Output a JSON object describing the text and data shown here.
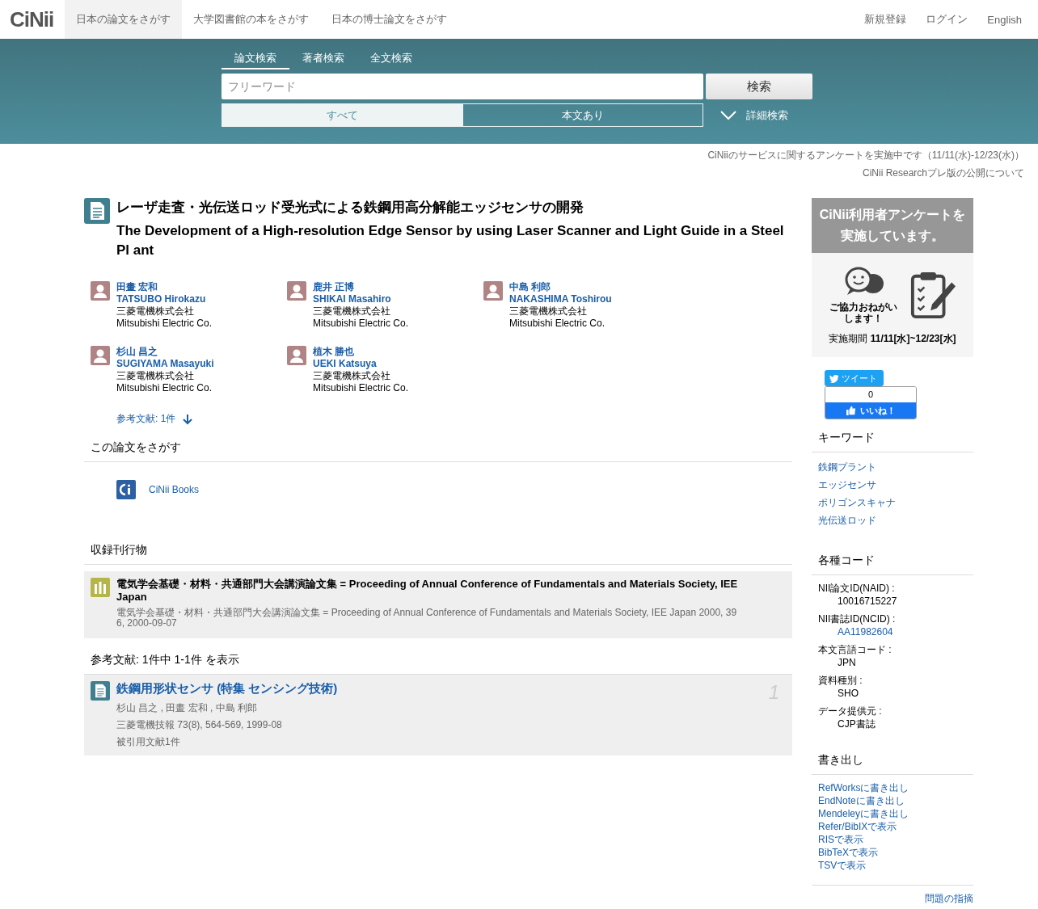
{
  "header": {
    "logo": "CiNii",
    "nav": [
      {
        "label": "日本の論文をさがす",
        "selected": true
      },
      {
        "label": "大学図書館の本をさがす",
        "selected": false
      },
      {
        "label": "日本の博士論文をさがす",
        "selected": false
      }
    ],
    "account": [
      "新規登録",
      "ログイン",
      "English"
    ]
  },
  "search": {
    "tabs": [
      {
        "label": "論文検索",
        "selected": true
      },
      {
        "label": "著者検索",
        "selected": false
      },
      {
        "label": "全文検索",
        "selected": false
      }
    ],
    "placeholder": "フリーワード",
    "button": "検索",
    "filters": [
      {
        "label": "すべて",
        "selected": true
      },
      {
        "label": "本文あり",
        "selected": false
      }
    ],
    "advanced": "詳細検索"
  },
  "notices": [
    "CiNiiのサービスに関するアンケートを実施中です（11/11(水)-12/23(水)）",
    "CiNii Researchプレ版の公開について"
  ],
  "article": {
    "title_ja": "レーザ走査・光伝送ロッド受光式による鉄鋼用高分解能エッジセンサの開発",
    "title_en": "The Development of a High-resolution Edge Sensor by using Laser Scanner and Light Guide in a Steel Pl ant",
    "authors": [
      {
        "name_ja": "田畫 宏和",
        "name_en": "TATSUBO Hirokazu",
        "affil_ja": "三菱電機株式会社",
        "affil_en": "Mitsubishi Electric Co."
      },
      {
        "name_ja": "鹿井 正博",
        "name_en": "SHIKAI Masahiro",
        "affil_ja": "三菱電機株式会社",
        "affil_en": "Mitsubishi Electric Co."
      },
      {
        "name_ja": "中島 利郎",
        "name_en": "NAKASHIMA Toshirou",
        "affil_ja": "三菱電機株式会社",
        "affil_en": "Mitsubishi Electric Co."
      },
      {
        "name_ja": "杉山 昌之",
        "name_en": "SUGIYAMA Masayuki",
        "affil_ja": "三菱電機株式会社",
        "affil_en": "Mitsubishi Electric Co."
      },
      {
        "name_ja": "植木 勝也",
        "name_en": "UEKI Katsuya",
        "affil_ja": "三菱電機株式会社",
        "affil_en": "Mitsubishi Electric Co."
      }
    ],
    "refs_link": "参考文献: 1件"
  },
  "find": {
    "heading": "この論文をさがす",
    "items": [
      "CiNii Books"
    ]
  },
  "journal": {
    "heading": "収録刊行物",
    "title": "電気学会基礎・材料・共通部門大会講演論文集 = Proceeding of Annual Conference of Fundamentals and Materials Society, IEE Japan",
    "detail": "電気学会基礎・材料・共通部門大会講演論文集 = Proceeding of Annual Conference of Fundamentals and Materials Society, IEE Japan 2000, 39 6, 2000-09-07"
  },
  "references": {
    "heading": "参考文献:  1件中 1-1件 を表示",
    "items": [
      {
        "title": "鉄鋼用形状センサ (特集 センシング技術)",
        "authors": "杉山 昌之 , 田畫 宏和 , 中島 利郎",
        "source": "三菱電機技報 73(8), 564-569, 1999-08",
        "cited": "被引用文献1件",
        "number": "1"
      }
    ]
  },
  "sidebar": {
    "banner": {
      "title": "CiNii利用者アンケートを実施しています。",
      "caption": "ご協力おねがいします！",
      "period": "実施期間 **11/11[水]~12/23[水]**"
    },
    "social": {
      "tweet": "ツイート",
      "like_count": "0",
      "like": "いいね！"
    },
    "keywords": {
      "heading": "キーワード",
      "items": [
        "鉄鋼プラント",
        "エッジセンサ",
        "ポリゴンスキャナ",
        "光伝送ロッド"
      ]
    },
    "codes": {
      "heading": "各種コード",
      "items": [
        {
          "label": "NII論文ID(NAID) :",
          "value": "10016715227",
          "link": false
        },
        {
          "label": "NII書誌ID(NCID) :",
          "value": "AA11982604",
          "link": true
        },
        {
          "label": "本文言語コード :",
          "value": "JPN",
          "link": false
        },
        {
          "label": "資料種別 :",
          "value": "SHO",
          "link": false
        },
        {
          "label": "データ提供元 :",
          "value": "CJP書誌",
          "link": false
        }
      ]
    },
    "export": {
      "heading": "書き出し",
      "items": [
        "RefWorksに書き出し",
        "EndNoteに書き出し",
        "Mendeleyに書き出し",
        "Refer/BibIXで表示",
        "RISで表示",
        "BibTeXで表示",
        "TSVで表示"
      ]
    },
    "report": "問題の指摘"
  }
}
